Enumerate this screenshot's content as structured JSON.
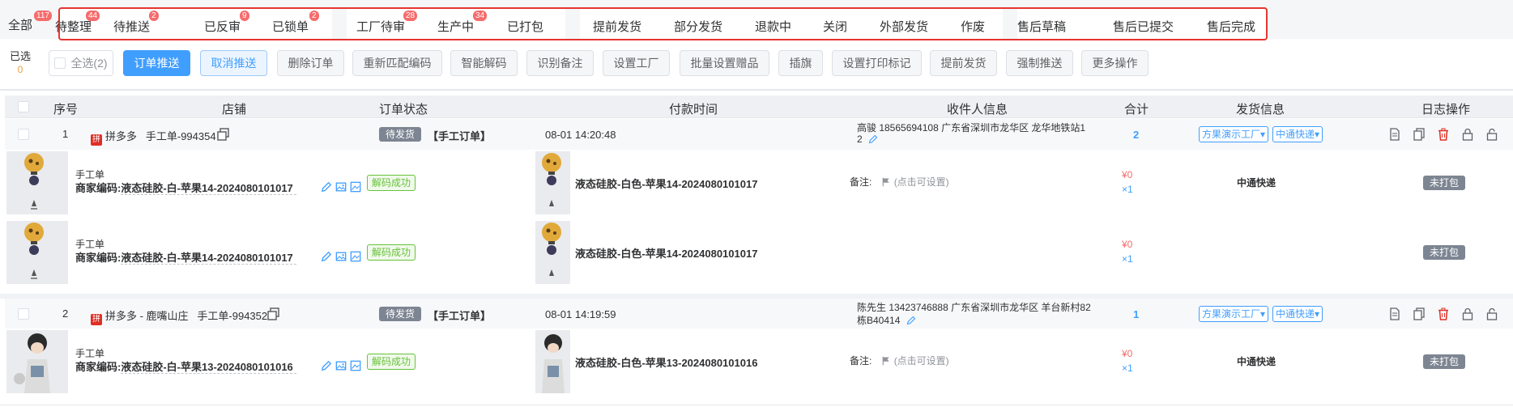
{
  "tabs": {
    "all": {
      "label": "全部",
      "badge": "117"
    },
    "group1": [
      {
        "label": "待整理",
        "badge": "44"
      },
      {
        "label": "待推送",
        "badge": "2"
      },
      {
        "label": "已反审",
        "badge": "9"
      },
      {
        "label": "已锁单",
        "badge": "2"
      }
    ],
    "group2": [
      {
        "label": "工厂待审",
        "badge": "28"
      },
      {
        "label": "生产中",
        "badge": "34"
      },
      {
        "label": "已打包",
        "badge": ""
      }
    ],
    "group3": [
      {
        "label": "提前发货"
      },
      {
        "label": "部分发货"
      },
      {
        "label": "退款中"
      },
      {
        "label": "关闭"
      },
      {
        "label": "外部发货"
      },
      {
        "label": "作废"
      }
    ],
    "group4": [
      {
        "label": "售后草稿"
      },
      {
        "label": "售后已提交"
      },
      {
        "label": "售后完成"
      }
    ]
  },
  "toolbar": {
    "selected_label": "已选",
    "selected_count": "0",
    "select_all": "全选(2)",
    "buttons": [
      "订单推送",
      "取消推送",
      "删除订单",
      "重新匹配编码",
      "智能解码",
      "识别备注",
      "设置工厂",
      "批量设置赠品",
      "插旗",
      "设置打印标记",
      "提前发货",
      "强制推送",
      "更多操作"
    ]
  },
  "table": {
    "headers": [
      "序号",
      "店铺",
      "订单状态",
      "付款时间",
      "收件人信息",
      "合计",
      "发货信息",
      "日志操作"
    ]
  },
  "orders": [
    {
      "index": "1",
      "shop_icon": "拼",
      "shop": "拼多多",
      "order_no": "手工单-994354",
      "status": "待发货",
      "order_type": "【手工订单】",
      "pay_time": "08-01 14:20:48",
      "recipient_line1": "高骏  18565694108  广东省深圳市龙华区 龙华地铁站1",
      "recipient_line2": "2",
      "total": "2",
      "factory": "方果演示工厂▾",
      "express": "中通快递▾",
      "items": [
        {
          "title": "手工单",
          "code_label": "商家编码:",
          "code": "液态硅胶-白-苹果14-2024080101017",
          "decode": "解码成功",
          "product": "液态硅胶-白色-苹果14-2024080101017",
          "remark_label": "备注:",
          "remark": "(点击可设置)",
          "price": "¥0",
          "qty": "×1",
          "express": "中通快递",
          "pack": "未打包"
        },
        {
          "title": "手工单",
          "code_label": "商家编码:",
          "code": "液态硅胶-白-苹果14-2024080101017",
          "decode": "解码成功",
          "product": "液态硅胶-白色-苹果14-2024080101017",
          "remark_label": "",
          "remark": "",
          "price": "¥0",
          "qty": "×1",
          "express": "",
          "pack": "未打包"
        }
      ]
    },
    {
      "index": "2",
      "shop_icon": "拼",
      "shop": "拼多多 - 鹿嘴山庄",
      "order_no": "手工单-994352",
      "status": "待发货",
      "order_type": "【手工订单】",
      "pay_time": "08-01 14:19:59",
      "recipient_line1": "陈先生  13423746888  广东省深圳市龙华区 羊台新村82",
      "recipient_line2": "栋B40414",
      "total": "1",
      "factory": "方果演示工厂▾",
      "express": "中通快递▾",
      "items": [
        {
          "title": "手工单",
          "code_label": "商家编码:",
          "code": "液态硅胶-白-苹果13-2024080101016",
          "decode": "解码成功",
          "product": "液态硅胶-白色-苹果13-2024080101016",
          "remark_label": "备注:",
          "remark": "(点击可设置)",
          "price": "¥0",
          "qty": "×1",
          "express": "中通快递",
          "pack": "未打包"
        }
      ]
    }
  ],
  "icons": [
    "copy-icon",
    "edit-icon",
    "image-icon",
    "flag-icon",
    "document-icon",
    "copy-doc-icon",
    "trash-icon",
    "lock-icon",
    "unlock-icon"
  ],
  "colors": {
    "primary": "#409eff",
    "danger": "#f56c6c",
    "success": "#67c23a",
    "highlight_border": "#e8342f"
  }
}
